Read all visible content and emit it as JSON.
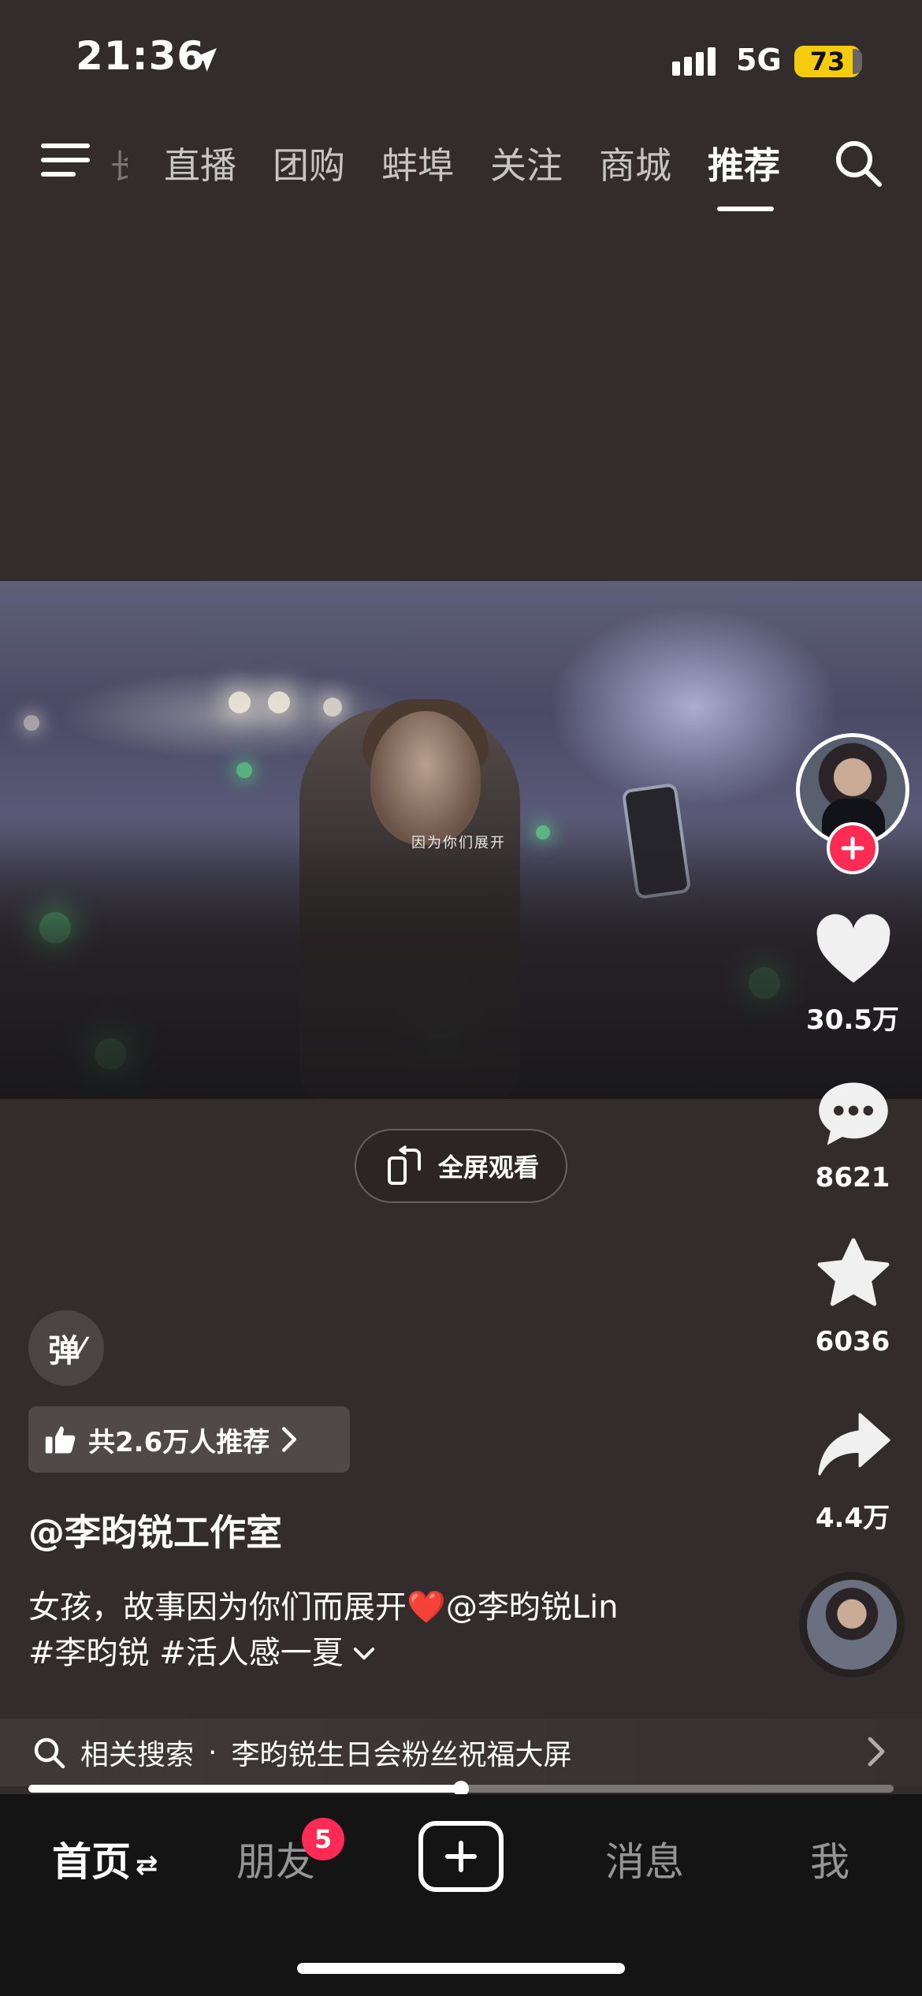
{
  "status_bar": {
    "time": "21:36",
    "network": "5G",
    "battery": "73",
    "icons": [
      "location-arrow-icon",
      "signal-bars-icon",
      "battery-icon"
    ]
  },
  "top_nav": {
    "partial_tab": "长",
    "tabs": [
      "直播",
      "团购",
      "蚌埠",
      "关注",
      "商城",
      "推荐"
    ],
    "active_tab": "推荐",
    "icons": [
      "menu-icon",
      "search-icon"
    ]
  },
  "video": {
    "subtitle": "因为你们展开"
  },
  "fullscreen": {
    "label": "全屏观看",
    "icon": "rotate-screen-icon"
  },
  "right_rail": {
    "likes": "30.5万",
    "comments": "8621",
    "favorites": "6036",
    "shares": "4.4万",
    "icons": [
      "avatar",
      "follow-plus-icon",
      "heart-icon",
      "comment-icon",
      "star-icon",
      "share-icon",
      "music-disc"
    ]
  },
  "info": {
    "danmaku_label": "弹",
    "recommend_text": "共2.6万人推荐",
    "author": "@李昀锐工作室",
    "desc_line1_text": "女孩，故事因为你们而展开",
    "desc_heart": "❤️",
    "desc_line1_mention": "@李昀锐Lin",
    "desc_line2": "#李昀锐 #活人感一夏",
    "related_label": "相关搜索",
    "related_sep": "·",
    "related_query": "李昀锐生日会粉丝祝福大屏"
  },
  "progress": {
    "fraction": 0.5
  },
  "bottom_nav": {
    "items": [
      "首页",
      "朋友",
      "消息",
      "我"
    ],
    "active": "首页",
    "friends_badge": "5",
    "create_icon": "plus-icon"
  },
  "colors": {
    "background": "#332c2c",
    "accent": "#fe2c55",
    "battery": "#f5cc0c"
  }
}
